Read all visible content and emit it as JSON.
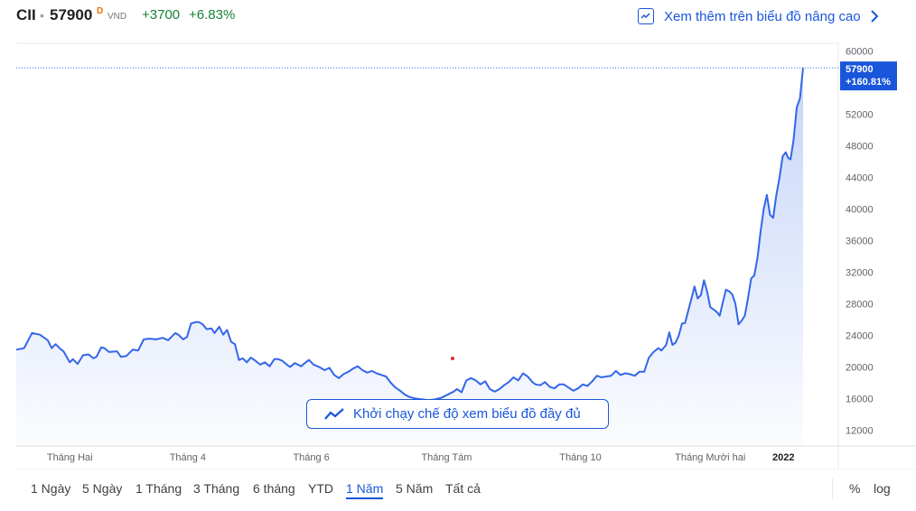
{
  "header": {
    "ticker": "CII",
    "separator": "•",
    "price": "57900",
    "badge": "D",
    "currency": "VND",
    "change": "+3700",
    "change_pct": "+6.83%",
    "advanced_link": "Xem thêm trên biểu đồ nâng cao",
    "advanced_icon": "chart-line-icon",
    "chevron_icon": "chevron-right-icon"
  },
  "colors": {
    "line": "#3367e8",
    "positive": "#188038",
    "accent": "#1a56db",
    "badge": "#e37400",
    "marker": "#d93025"
  },
  "launch_button": {
    "label": "Khởi chạy chế độ xem biểu đồ đầy đủ",
    "icon": "trend-line-icon"
  },
  "range_bar": {
    "items": [
      "1 Ngày",
      "5 Ngày",
      "1 Tháng",
      "3 Tháng",
      "6 tháng",
      "YTD",
      "1 Năm",
      "5 Năm",
      "Tất cả"
    ],
    "active_index": 6,
    "percent_label": "%",
    "log_label": "log"
  },
  "chart_data": {
    "type": "area",
    "grid": false,
    "y_axis_position": "right",
    "ylim": [
      10000,
      61000
    ],
    "yticks": [
      60000,
      52000,
      48000,
      44000,
      40000,
      36000,
      32000,
      28000,
      24000,
      20000,
      16000,
      12000
    ],
    "xlim": [
      0,
      1
    ],
    "xticks": [
      {
        "label": "Tháng Hai",
        "x": 0.068,
        "bold": false
      },
      {
        "label": "Tháng 4",
        "x": 0.218,
        "bold": false
      },
      {
        "label": "Tháng 6",
        "x": 0.375,
        "bold": false
      },
      {
        "label": "Tháng Tám",
        "x": 0.547,
        "bold": false
      },
      {
        "label": "Tháng 10",
        "x": 0.717,
        "bold": false
      },
      {
        "label": "Tháng Mười hai",
        "x": 0.882,
        "bold": false
      },
      {
        "label": "2022",
        "x": 0.975,
        "bold": true
      }
    ],
    "last_value": {
      "value": "57900",
      "change": "+160.81%"
    },
    "reference_value": 57900,
    "series": [
      {
        "points": [
          [
            0.0,
            22200
          ],
          [
            0.01,
            22400
          ],
          [
            0.02,
            24300
          ],
          [
            0.03,
            24100
          ],
          [
            0.04,
            23400
          ],
          [
            0.045,
            22400
          ],
          [
            0.05,
            22900
          ],
          [
            0.056,
            22300
          ],
          [
            0.06,
            22000
          ],
          [
            0.068,
            20600
          ],
          [
            0.072,
            21000
          ],
          [
            0.078,
            20400
          ],
          [
            0.085,
            21500
          ],
          [
            0.092,
            21600
          ],
          [
            0.098,
            21100
          ],
          [
            0.102,
            21300
          ],
          [
            0.108,
            22500
          ],
          [
            0.112,
            22400
          ],
          [
            0.118,
            21900
          ],
          [
            0.128,
            22000
          ],
          [
            0.133,
            21300
          ],
          [
            0.14,
            21400
          ],
          [
            0.148,
            22200
          ],
          [
            0.155,
            22100
          ],
          [
            0.162,
            23500
          ],
          [
            0.17,
            23600
          ],
          [
            0.178,
            23500
          ],
          [
            0.186,
            23700
          ],
          [
            0.193,
            23400
          ],
          [
            0.198,
            23900
          ],
          [
            0.202,
            24300
          ],
          [
            0.206,
            24100
          ],
          [
            0.212,
            23500
          ],
          [
            0.217,
            23800
          ],
          [
            0.222,
            25500
          ],
          [
            0.228,
            25700
          ],
          [
            0.232,
            25700
          ],
          [
            0.237,
            25400
          ],
          [
            0.242,
            24800
          ],
          [
            0.248,
            24900
          ],
          [
            0.252,
            24300
          ],
          [
            0.258,
            25100
          ],
          [
            0.263,
            24100
          ],
          [
            0.268,
            24700
          ],
          [
            0.273,
            23200
          ],
          [
            0.278,
            22900
          ],
          [
            0.283,
            20900
          ],
          [
            0.288,
            21100
          ],
          [
            0.293,
            20600
          ],
          [
            0.298,
            21200
          ],
          [
            0.304,
            20800
          ],
          [
            0.31,
            20300
          ],
          [
            0.316,
            20600
          ],
          [
            0.322,
            20100
          ],
          [
            0.328,
            21000
          ],
          [
            0.333,
            21000
          ],
          [
            0.338,
            20800
          ],
          [
            0.344,
            20300
          ],
          [
            0.348,
            20000
          ],
          [
            0.354,
            20500
          ],
          [
            0.362,
            20100
          ],
          [
            0.368,
            20600
          ],
          [
            0.372,
            20900
          ],
          [
            0.378,
            20300
          ],
          [
            0.385,
            20000
          ],
          [
            0.392,
            19600
          ],
          [
            0.398,
            19900
          ],
          [
            0.404,
            19000
          ],
          [
            0.41,
            18600
          ],
          [
            0.416,
            19100
          ],
          [
            0.422,
            19400
          ],
          [
            0.428,
            19800
          ],
          [
            0.434,
            20100
          ],
          [
            0.44,
            19600
          ],
          [
            0.446,
            19300
          ],
          [
            0.452,
            19500
          ],
          [
            0.458,
            19200
          ],
          [
            0.464,
            19000
          ],
          [
            0.47,
            18800
          ],
          [
            0.476,
            18000
          ],
          [
            0.482,
            17400
          ],
          [
            0.488,
            17000
          ],
          [
            0.494,
            16500
          ],
          [
            0.5,
            16200
          ],
          [
            0.508,
            16000
          ],
          [
            0.516,
            15900
          ],
          [
            0.524,
            15800
          ],
          [
            0.532,
            15900
          ],
          [
            0.54,
            16100
          ],
          [
            0.55,
            16600
          ],
          [
            0.556,
            16900
          ],
          [
            0.56,
            17200
          ],
          [
            0.566,
            16800
          ],
          [
            0.572,
            18300
          ],
          [
            0.578,
            18600
          ],
          [
            0.584,
            18300
          ],
          [
            0.59,
            17800
          ],
          [
            0.596,
            18200
          ],
          [
            0.602,
            17200
          ],
          [
            0.608,
            16900
          ],
          [
            0.614,
            17200
          ],
          [
            0.62,
            17700
          ],
          [
            0.626,
            18100
          ],
          [
            0.632,
            18700
          ],
          [
            0.638,
            18300
          ],
          [
            0.644,
            19200
          ],
          [
            0.65,
            18800
          ],
          [
            0.656,
            18100
          ],
          [
            0.66,
            17800
          ],
          [
            0.666,
            17700
          ],
          [
            0.672,
            18100
          ],
          [
            0.678,
            17500
          ],
          [
            0.684,
            17300
          ],
          [
            0.69,
            17800
          ],
          [
            0.696,
            17800
          ],
          [
            0.702,
            17400
          ],
          [
            0.708,
            17000
          ],
          [
            0.714,
            17300
          ],
          [
            0.72,
            17800
          ],
          [
            0.726,
            17600
          ],
          [
            0.732,
            18200
          ],
          [
            0.738,
            18900
          ],
          [
            0.744,
            18700
          ],
          [
            0.75,
            18800
          ],
          [
            0.756,
            18900
          ],
          [
            0.762,
            19500
          ],
          [
            0.768,
            19000
          ],
          [
            0.774,
            19200
          ],
          [
            0.78,
            19100
          ],
          [
            0.786,
            18900
          ],
          [
            0.792,
            19400
          ],
          [
            0.798,
            19400
          ],
          [
            0.804,
            21200
          ],
          [
            0.81,
            21900
          ],
          [
            0.816,
            22400
          ],
          [
            0.82,
            22100
          ],
          [
            0.826,
            22800
          ],
          [
            0.83,
            24400
          ],
          [
            0.834,
            22800
          ],
          [
            0.838,
            23100
          ],
          [
            0.842,
            24000
          ],
          [
            0.846,
            25500
          ],
          [
            0.85,
            25600
          ],
          [
            0.855,
            27500
          ],
          [
            0.858,
            28600
          ],
          [
            0.862,
            30200
          ],
          [
            0.866,
            28700
          ],
          [
            0.87,
            29100
          ],
          [
            0.874,
            31000
          ],
          [
            0.878,
            29600
          ],
          [
            0.882,
            27600
          ],
          [
            0.886,
            27300
          ],
          [
            0.89,
            27000
          ],
          [
            0.894,
            26500
          ],
          [
            0.898,
            28200
          ],
          [
            0.902,
            29800
          ],
          [
            0.906,
            29600
          ],
          [
            0.91,
            29200
          ],
          [
            0.914,
            28000
          ],
          [
            0.918,
            25400
          ],
          [
            0.922,
            25900
          ],
          [
            0.926,
            26500
          ],
          [
            0.93,
            28700
          ],
          [
            0.934,
            31200
          ],
          [
            0.938,
            31600
          ],
          [
            0.942,
            33800
          ],
          [
            0.946,
            37200
          ],
          [
            0.95,
            40000
          ],
          [
            0.954,
            41800
          ],
          [
            0.958,
            39300
          ],
          [
            0.962,
            38900
          ],
          [
            0.966,
            41800
          ],
          [
            0.97,
            44000
          ],
          [
            0.974,
            46700
          ],
          [
            0.978,
            47200
          ],
          [
            0.981,
            46500
          ],
          [
            0.984,
            46300
          ],
          [
            0.988,
            48800
          ],
          [
            0.992,
            52900
          ],
          [
            0.996,
            54000
          ],
          [
            1.0,
            57900
          ]
        ]
      }
    ]
  }
}
